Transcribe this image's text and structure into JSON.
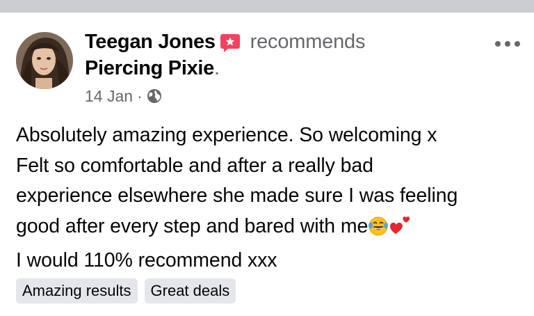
{
  "post": {
    "author_name": "Teegan Jones",
    "author_badge_icon": "recommendation-badge-icon",
    "action_text": "recommends",
    "page_name": "Piercing Pixie",
    "page_name_suffix": ".",
    "date": "14 Jan",
    "date_separator": "·",
    "privacy_icon": "globe-icon",
    "menu_icon": "more-options-icon",
    "body_lines": [
      "Absolutely amazing experience. So welcoming x",
      "Felt so comfortable and after a really bad",
      "experience elsewhere she made sure I was feeling",
      "good after every step and bared with me",
      "I would 110% recommend xxx"
    ],
    "emojis": [
      "laughing-tears-emoji",
      "heart-emoji"
    ],
    "tags": [
      "Amazing results",
      "Great deals"
    ]
  },
  "colors": {
    "badge": "#f3425f",
    "secondary_text": "#65676b",
    "tag_background": "#e4e6eb",
    "top_bar": "#c9ccd1"
  }
}
